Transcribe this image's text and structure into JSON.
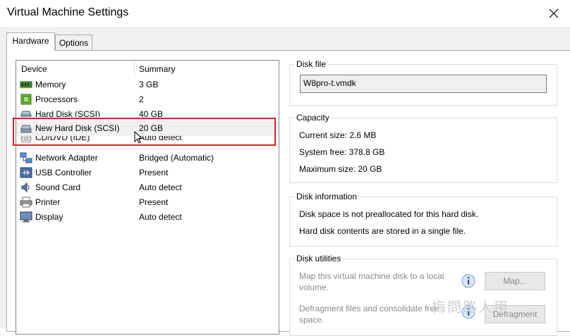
{
  "window": {
    "title": "Virtual Machine Settings"
  },
  "tabs": [
    {
      "label": "Hardware",
      "active": true
    },
    {
      "label": "Options",
      "active": false
    }
  ],
  "device_list": {
    "headers": {
      "device": "Device",
      "summary": "Summary"
    },
    "rows": [
      {
        "name": "Memory",
        "summary": "3 GB",
        "icon": "memory-icon"
      },
      {
        "name": "Processors",
        "summary": "2",
        "icon": "processor-icon"
      },
      {
        "name": "Hard Disk (SCSI)",
        "summary": "40 GB",
        "icon": "hard-disk-icon"
      },
      {
        "name": "New Hard Disk (SCSI)",
        "summary": "20 GB",
        "icon": "hard-disk-icon",
        "selected": true
      },
      {
        "name": "CD/DVD (IDE)",
        "summary": "Auto detect",
        "icon": "cd-dvd-icon"
      },
      {
        "name": "Network Adapter",
        "summary": "Bridged (Automatic)",
        "icon": "network-adapter-icon"
      },
      {
        "name": "USB Controller",
        "summary": "Present",
        "icon": "usb-icon"
      },
      {
        "name": "Sound Card",
        "summary": "Auto detect",
        "icon": "speaker-icon"
      },
      {
        "name": "Printer",
        "summary": "Present",
        "icon": "printer-icon"
      },
      {
        "name": "Display",
        "summary": "Auto detect",
        "icon": "monitor-icon"
      }
    ]
  },
  "disk_file": {
    "title": "Disk file",
    "value": "W8pro-t.vmdk"
  },
  "capacity": {
    "title": "Capacity",
    "current_size": "Current size: 2.6 MB",
    "system_free": "System free: 378.8 GB",
    "maximum_size": "Maximum size: 20 GB"
  },
  "disk_information": {
    "title": "Disk information",
    "line1": "Disk space is not preallocated for this hard disk.",
    "line2": "Hard disk contents are stored in a single file."
  },
  "disk_utilities": {
    "title": "Disk utilities",
    "map_text": "Map this virtual machine disk to a local volume.",
    "map_button": "Map...",
    "defrag_text": "Defragment files and consolidate free space.",
    "defrag_button": "Defragment"
  },
  "watermark": "梅問路人甲",
  "colors": {
    "highlight": "#e02020",
    "panel_bg": "#f0f0f0",
    "disabled_text": "#8a8a8a"
  }
}
